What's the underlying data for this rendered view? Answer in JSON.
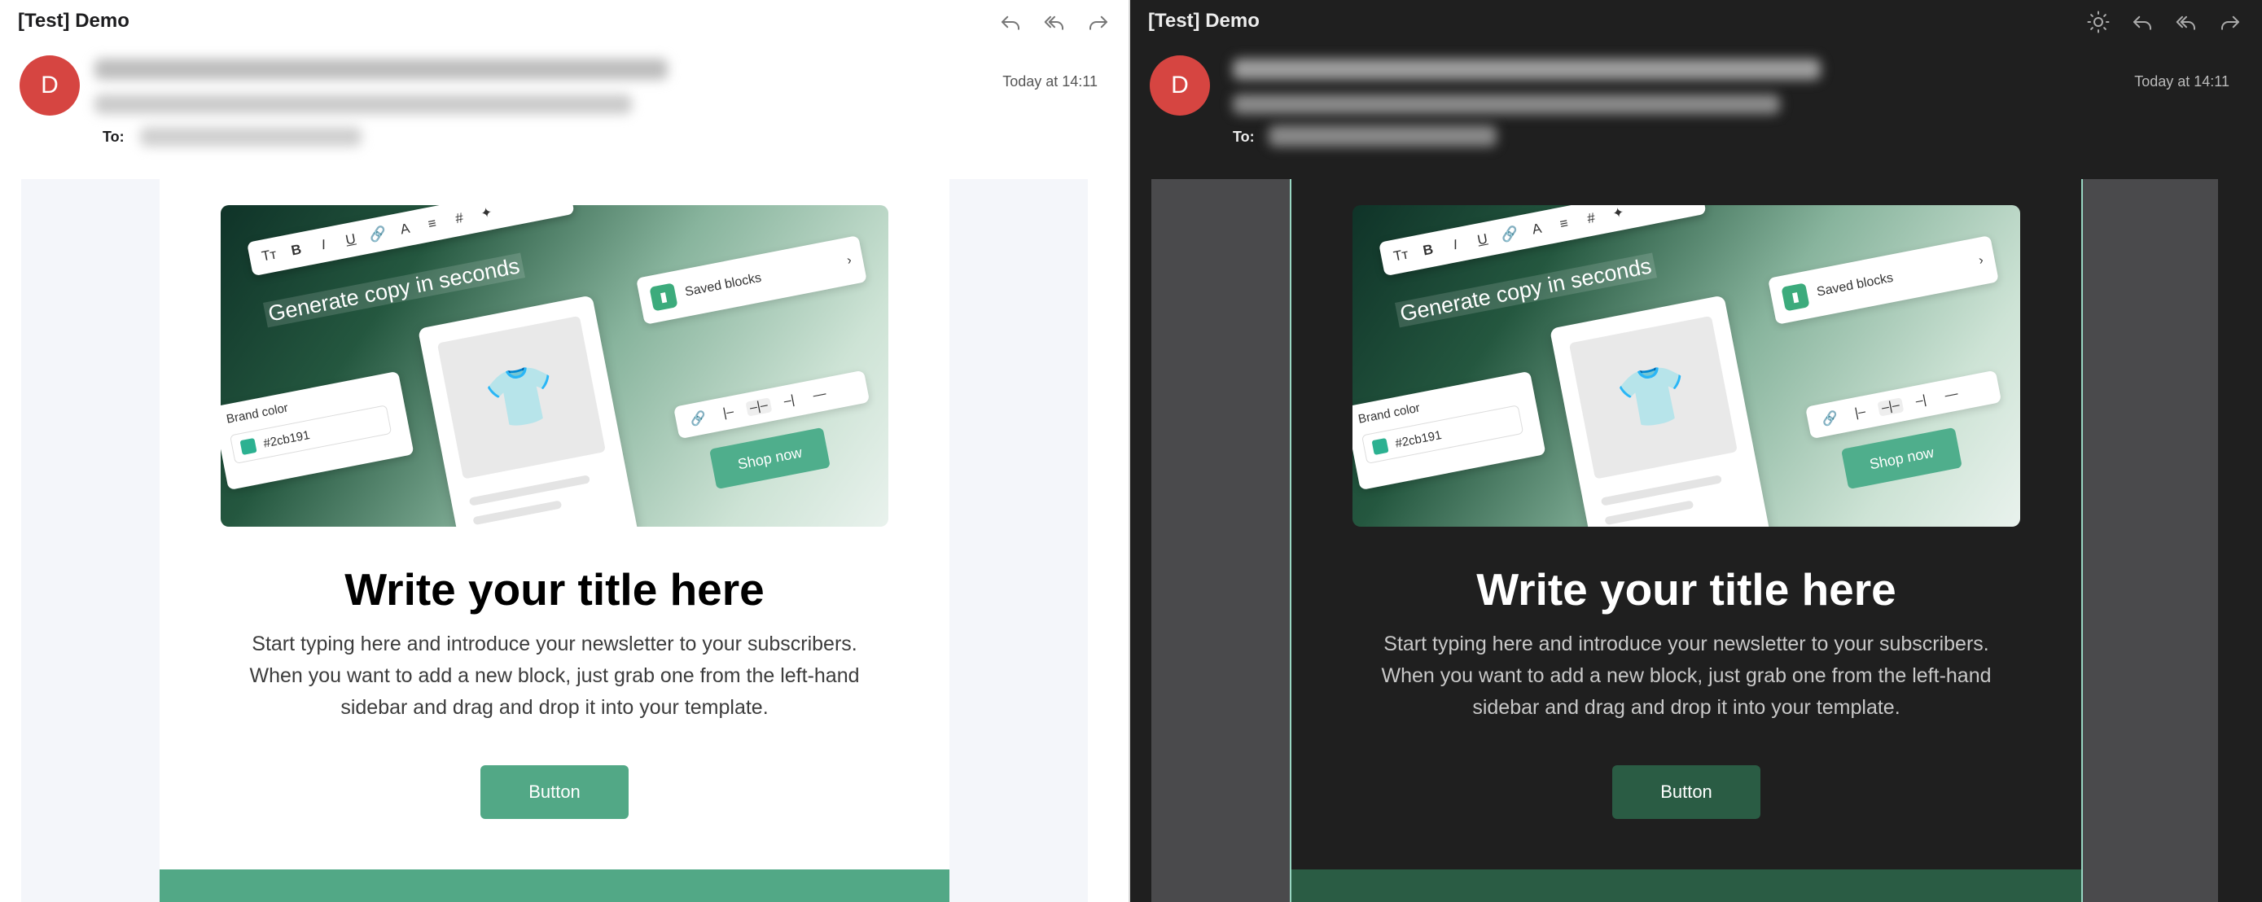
{
  "light": {
    "subject": "[Test] Demo",
    "avatar_letter": "D",
    "date": "Today at 14:11",
    "to_label": "To:",
    "hero": {
      "toolbar": [
        "Tт",
        "B",
        "I",
        "U",
        "🔗",
        "A",
        "≡",
        "#",
        "✦"
      ],
      "generate_text": "Generate copy in seconds",
      "saved_blocks": "Saved blocks",
      "brand_label": "Brand color",
      "brand_value": "#2cb191",
      "toolbar2": [
        "🔗",
        "|–",
        "–|–",
        "–|",
        "—"
      ],
      "shop_now": "Shop now"
    },
    "title": "Write your title here",
    "body": "Start typing here and introduce your newsletter to your subscribers. When you want to add a new block, just grab one from the left-hand sidebar and drag and drop it into your template.",
    "button": "Button"
  },
  "dark": {
    "subject": "[Test] Demo",
    "avatar_letter": "D",
    "date": "Today at 14:11",
    "to_label": "To:",
    "hero": {
      "toolbar": [
        "Tт",
        "B",
        "I",
        "U",
        "🔗",
        "A",
        "≡",
        "#",
        "✦"
      ],
      "generate_text": "Generate copy in seconds",
      "saved_blocks": "Saved blocks",
      "brand_label": "Brand color",
      "brand_value": "#2cb191",
      "toolbar2": [
        "🔗",
        "|–",
        "–|–",
        "–|",
        "—"
      ],
      "shop_now": "Shop now"
    },
    "title": "Write your title here",
    "body": "Start typing here and introduce your newsletter to your subscribers. When you want to add a new block, just grab one from the left-hand sidebar and drag and drop it into your template.",
    "button": "Button"
  },
  "colors": {
    "avatar": "#d64541",
    "brand_green": "#52a886",
    "brand_swatch": "#2cb191",
    "dark_button": "#2a5c44"
  },
  "icons": [
    "reply-icon",
    "reply-all-icon",
    "forward-icon",
    "brightness-icon"
  ]
}
